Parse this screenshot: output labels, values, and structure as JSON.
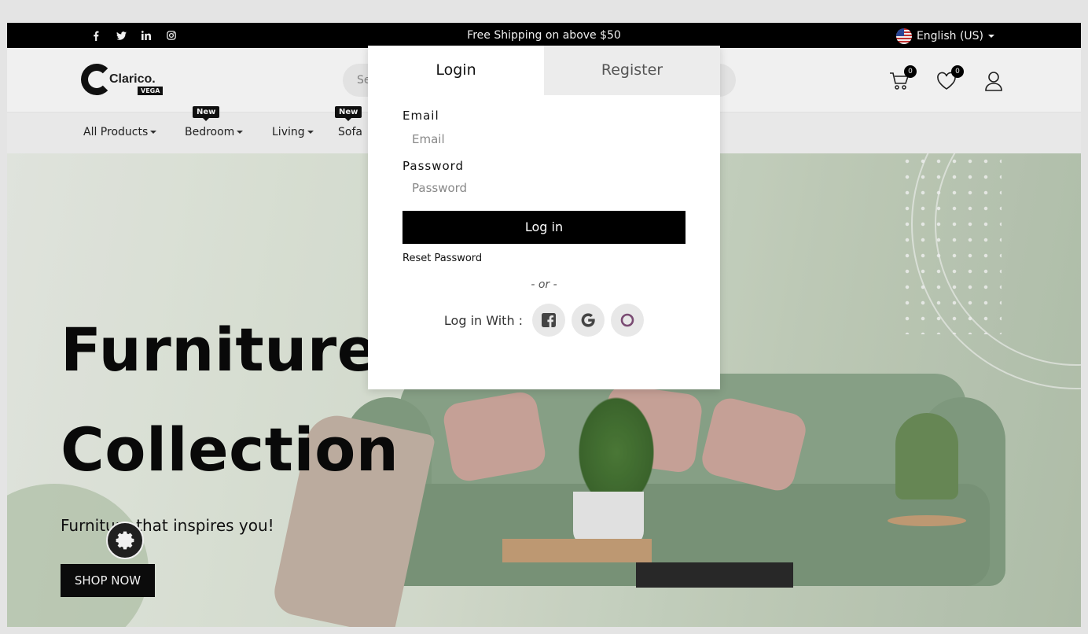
{
  "topbar": {
    "social_icons": [
      "facebook-icon",
      "twitter-icon",
      "linkedin-icon",
      "instagram-icon"
    ],
    "shipping_text": "Free Shipping on above $50",
    "language": "English (US)"
  },
  "header": {
    "logo_word": "Clarico.",
    "logo_tag": "VEGA",
    "search_placeholder": "Se",
    "cart_count": "0",
    "wishlist_count": "0"
  },
  "nav": {
    "items": [
      {
        "label": "All Products",
        "badge": ""
      },
      {
        "label": "Bedroom",
        "badge": "New"
      },
      {
        "label": "Living",
        "badge": ""
      },
      {
        "label": "Sofa",
        "badge": "New"
      }
    ]
  },
  "hero": {
    "title_line1": "Furniture",
    "title_line2": "Collection",
    "subtitle": "Furniture that inspires you!",
    "cta": "SHOP NOW"
  },
  "modal": {
    "tab_login": "Login",
    "tab_register": "Register",
    "email_label": "Email",
    "email_placeholder": "Email",
    "password_label": "Password",
    "password_placeholder": "Password",
    "login_button": "Log in",
    "reset_link": "Reset Password",
    "or_text": "- or -",
    "login_with": "Log in With :"
  },
  "colors": {
    "accent": "#000000",
    "badge_bg": "#111111",
    "tab_inactive_bg": "#ececec"
  }
}
